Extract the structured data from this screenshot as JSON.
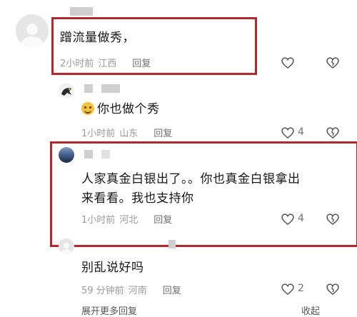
{
  "comments": [
    {
      "text": "蹭流量做秀，",
      "time": "2小时前",
      "location": "江西",
      "reply_label": "回复",
      "like_count": ""
    },
    {
      "emoji_icon": "grinning-face-emoji",
      "text": "你也做个秀",
      "time": "1小时前",
      "location": "山东",
      "reply_label": "回复",
      "like_count": "4"
    },
    {
      "text_line1": "人家真金白银出了。。你也真金白银拿出",
      "text_line2": "来看看。我也支持你",
      "time": "1小时前",
      "location": "河北",
      "reply_label": "回复",
      "like_count": "4"
    },
    {
      "text": "别乱说好吗",
      "time": "59 分钟前",
      "location": "河南",
      "reply_label": "回复",
      "like_count": "2"
    }
  ],
  "footer": {
    "expand_label": "展开更多回复",
    "collapse_label": "收起"
  },
  "colors": {
    "highlight_border": "#b3282d",
    "meta_text": "#9a9a9a",
    "body_text": "#161616"
  }
}
